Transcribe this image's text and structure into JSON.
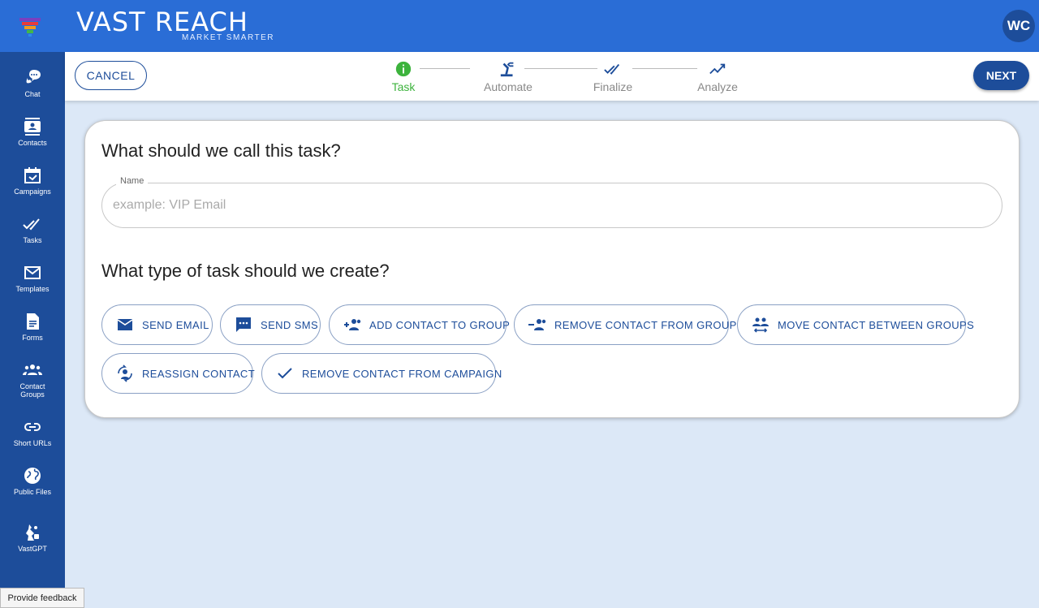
{
  "brand": {
    "name": "VAST REACH",
    "tagline": "MARKET SMARTER"
  },
  "user": {
    "initials": "WC"
  },
  "sidebar": {
    "items": [
      {
        "label": "Chat",
        "icon": "chat-icon"
      },
      {
        "label": "Contacts",
        "icon": "contacts-icon"
      },
      {
        "label": "Campaigns",
        "icon": "campaigns-icon"
      },
      {
        "label": "Tasks",
        "icon": "tasks-icon"
      },
      {
        "label": "Templates",
        "icon": "templates-icon"
      },
      {
        "label": "Forms",
        "icon": "forms-icon"
      },
      {
        "label": "Contact Groups",
        "icon": "contact-groups-icon"
      },
      {
        "label": "Short URLs",
        "icon": "link-icon"
      },
      {
        "label": "Public Files",
        "icon": "globe-icon"
      },
      {
        "label": "VastGPT",
        "icon": "robot-icon"
      }
    ]
  },
  "header": {
    "cancel_label": "CANCEL",
    "next_label": "NEXT",
    "steps": [
      {
        "label": "Task",
        "state": "active"
      },
      {
        "label": "Automate",
        "state": "inactive"
      },
      {
        "label": "Finalize",
        "state": "inactive"
      },
      {
        "label": "Analyze",
        "state": "inactive"
      }
    ]
  },
  "form": {
    "name_question": "What should we call this task?",
    "name_label": "Name",
    "name_placeholder": "example: VIP Email",
    "name_value": "",
    "type_question": "What type of task should we create?",
    "task_types": [
      {
        "label": "SEND EMAIL",
        "icon": "email-icon"
      },
      {
        "label": "SEND SMS",
        "icon": "sms-icon"
      },
      {
        "label": "ADD CONTACT TO GROUP",
        "icon": "group-add-icon"
      },
      {
        "label": "REMOVE CONTACT FROM GROUP",
        "icon": "group-remove-icon"
      },
      {
        "label": "MOVE CONTACT BETWEEN GROUPS",
        "icon": "group-move-icon"
      },
      {
        "label": "REASSIGN CONTACT",
        "icon": "reassign-icon"
      },
      {
        "label": "REMOVE CONTACT FROM CAMPAIGN",
        "icon": "check-icon"
      }
    ]
  },
  "feedback_label": "Provide feedback",
  "colors": {
    "primary": "#1d4d9a",
    "topbar": "#2a6dd6",
    "background": "#dce8f7",
    "active_step": "#3db33d"
  }
}
